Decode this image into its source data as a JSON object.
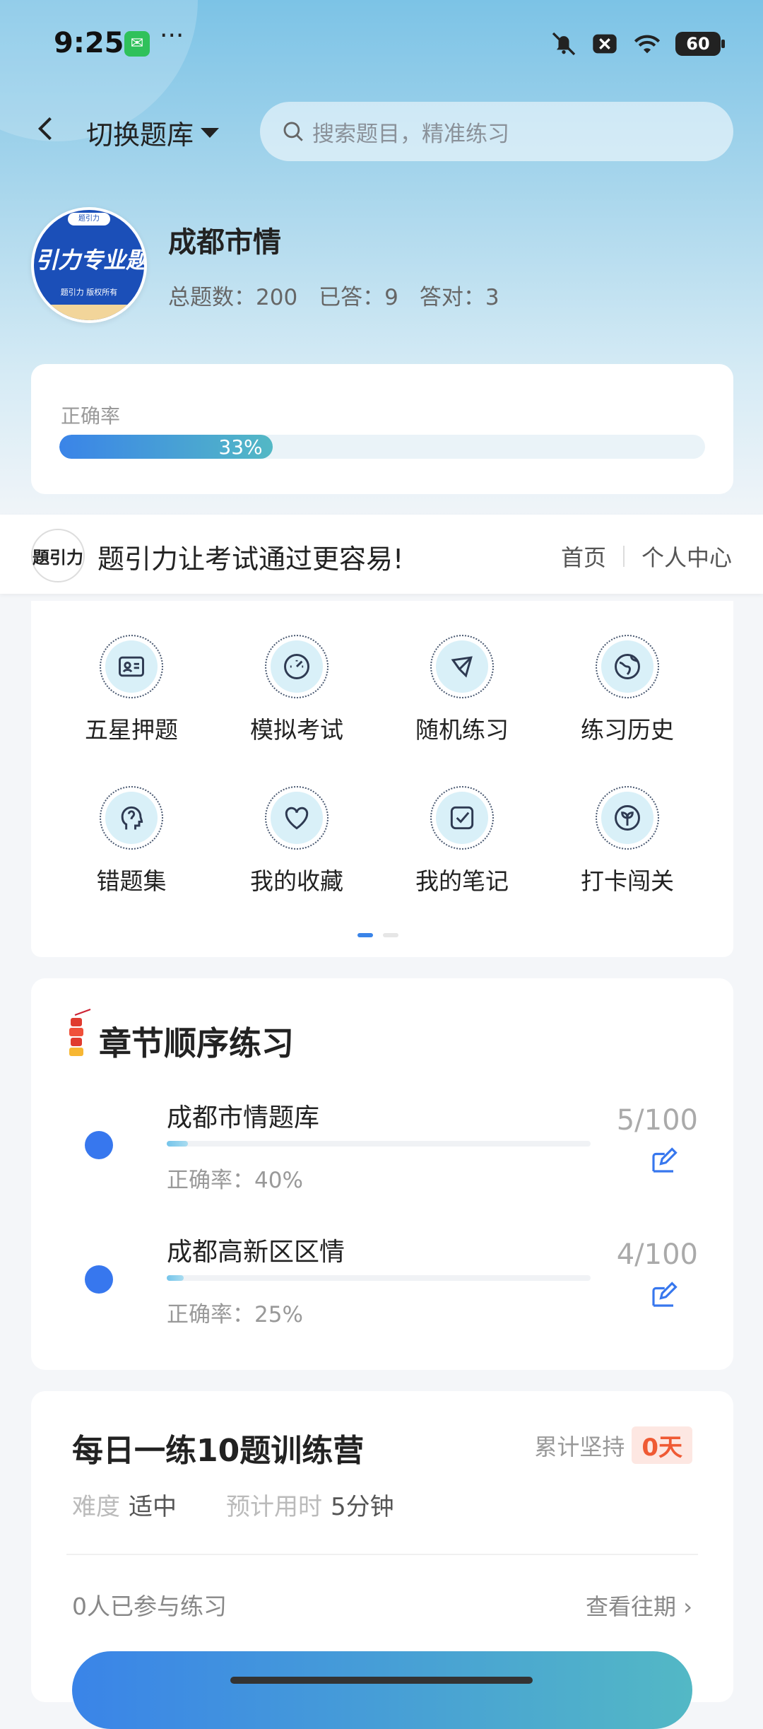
{
  "status_bar": {
    "time": "9:25",
    "battery": "60"
  },
  "header": {
    "switch_label": "切换题库",
    "search_placeholder": "搜索题目，精准练习"
  },
  "bank": {
    "title": "成都市情",
    "logo_text": "引力专业题",
    "logo_sub": "题引力 版权所有",
    "logo_tab": "题引力",
    "stats": {
      "total": "总题数：200",
      "answered": "已答：9",
      "correct": "答对：3"
    }
  },
  "accuracy": {
    "label": "正确率",
    "value_text": "33%",
    "value": 0.33
  },
  "banner": {
    "logo_text": "題引力",
    "slogan": "题引力让考试通过更容易!",
    "nav_home": "首页",
    "nav_profile": "个人中心"
  },
  "features": [
    {
      "label": "五星押题",
      "icon": "id-card-icon"
    },
    {
      "label": "模拟考试",
      "icon": "gauge-icon"
    },
    {
      "label": "随机练习",
      "icon": "network-icon"
    },
    {
      "label": "练习历史",
      "icon": "globe-icon"
    },
    {
      "label": "错题集",
      "icon": "head-icon"
    },
    {
      "label": "我的收藏",
      "icon": "heart-icon"
    },
    {
      "label": "我的笔记",
      "icon": "note-check-icon"
    },
    {
      "label": "打卡闯关",
      "icon": "leaf-icon"
    }
  ],
  "chapters": {
    "title": "章节顺序练习",
    "items": [
      {
        "name": "成都市情题库",
        "accuracy": "正确率：40%",
        "count": "5/100",
        "progress": 0.05
      },
      {
        "name": "成都高新区区情",
        "accuracy": "正确率：25%",
        "count": "4/100",
        "progress": 0.04
      }
    ]
  },
  "training": {
    "title": "每日一练10题训练营",
    "persist_label": "累计坚持",
    "days": "0天",
    "difficulty_label": "难度",
    "difficulty_value": "适中",
    "time_label": "预计用时",
    "time_value": "5分钟",
    "participants": "0人已参与练习",
    "past_link": "查看往期 ›"
  },
  "colors": {
    "accent": "#3777ee",
    "teal": "#53b8c5",
    "orange": "#ef5a34"
  }
}
